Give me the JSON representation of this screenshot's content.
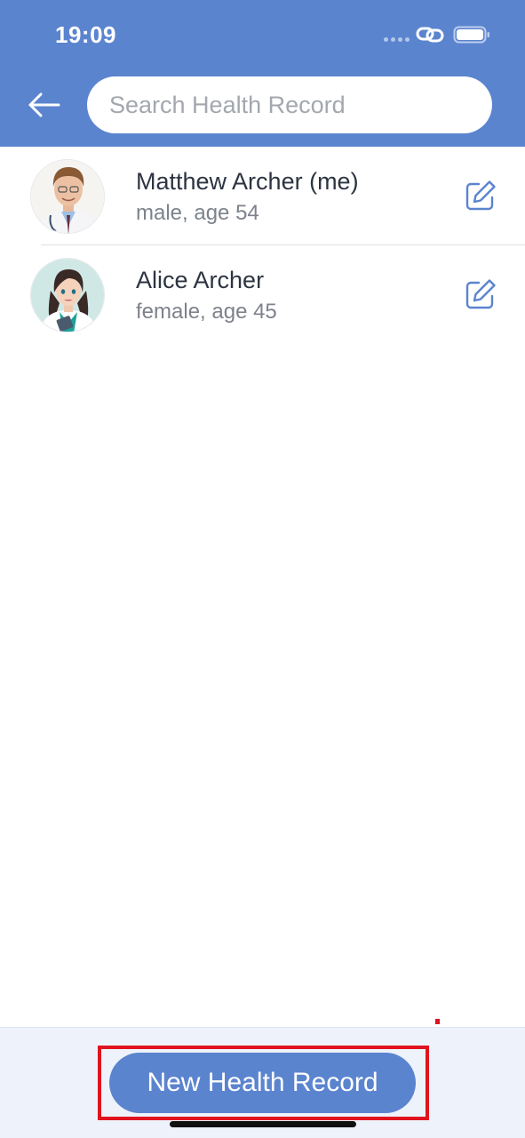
{
  "status_bar": {
    "time": "19:09",
    "icons": [
      "signal-dots-icon",
      "link-icon",
      "battery-icon"
    ]
  },
  "header": {
    "back_icon": "arrow-left-icon",
    "search": {
      "placeholder": "Search Health Record",
      "value": ""
    }
  },
  "records": [
    {
      "name": "Matthew Archer (me)",
      "details": "male, age 54",
      "avatar": "male-doctor-avatar",
      "edit_icon": "edit-icon"
    },
    {
      "name": "Alice Archer",
      "details": "female, age 45",
      "avatar": "female-nurse-avatar",
      "edit_icon": "edit-icon"
    }
  ],
  "footer": {
    "new_record_label": "New Health Record"
  },
  "colors": {
    "accent": "#5b84cf",
    "highlight": "#e0131e",
    "footer_bg": "#eef3fb"
  }
}
